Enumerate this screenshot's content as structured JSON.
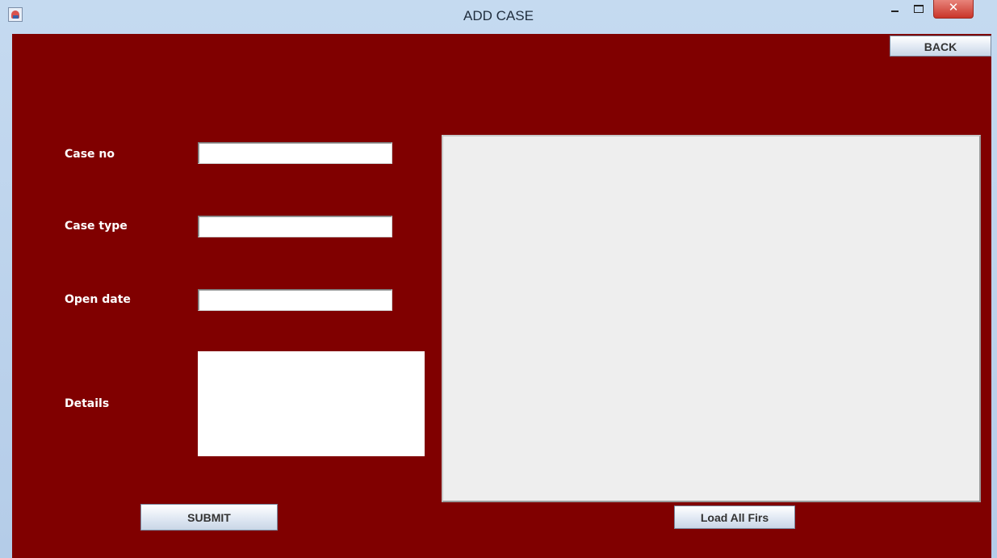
{
  "window": {
    "title": "ADD CASE",
    "close_glyph": "✕"
  },
  "toolbar": {
    "back_label": "BACK"
  },
  "form": {
    "case_no_label": "Case no",
    "case_no_value": "",
    "case_type_label": "Case type",
    "case_type_value": "",
    "open_date_label": "Open date",
    "open_date_value": "",
    "details_label": "Details",
    "details_value": "",
    "submit_label": "SUBMIT"
  },
  "table": {
    "load_label": "Load All Firs"
  },
  "colors": {
    "background": "#800000",
    "label_text": "#ffffff",
    "table_panel": "#eeeeee"
  },
  "icons": {
    "app": "java-app-icon",
    "minimize": "minimize-icon",
    "maximize": "maximize-icon",
    "close": "close-icon"
  }
}
